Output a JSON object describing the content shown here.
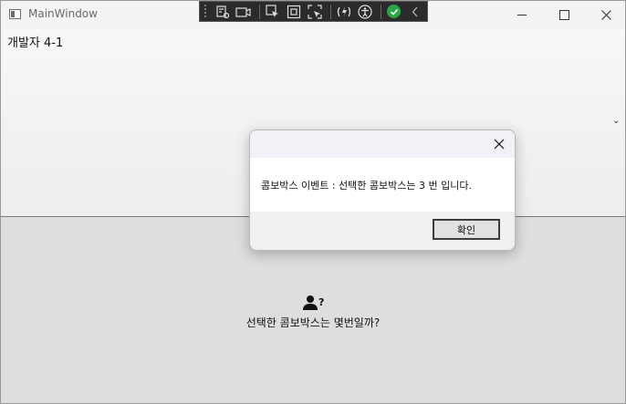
{
  "window": {
    "title": "MainWindow"
  },
  "main": {
    "developer_label": "개발자 4-1",
    "combo_arrow_icon": "chevron-down-icon",
    "question_text": "선택한 콤보박스는 몇번일까?",
    "user_icon": "user-question-icon"
  },
  "dialog": {
    "message": "콤보박스 이벤트 : 선택한 콤보박스는 3 번 입니다.",
    "ok_label": "확인"
  },
  "toolbar": {
    "icons": [
      "live-visual-tree-icon",
      "camera-icon",
      "select-element-icon",
      "display-adorners-icon",
      "track-focus-icon",
      "hot-reload-icon",
      "accessibility-icon",
      "binding-check-icon",
      "collapse-icon"
    ],
    "status_color": "#2aa74a"
  }
}
